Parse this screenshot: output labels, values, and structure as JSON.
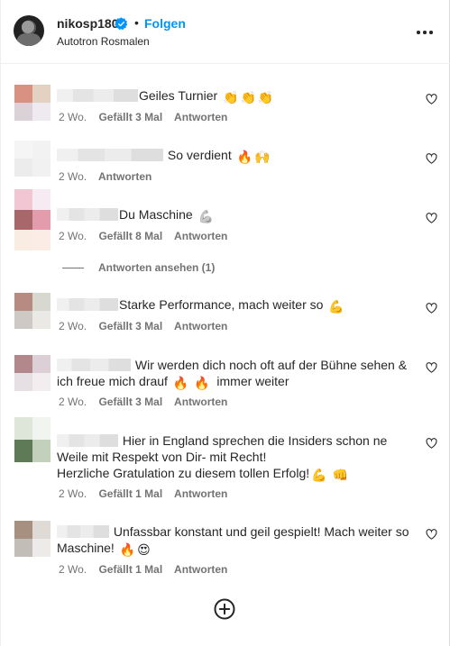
{
  "header": {
    "username": "nikosp180",
    "dot": "•",
    "follow_label": "Folgen",
    "location": "Autotron Rosmalen",
    "verified_icon": "verified-badge-icon",
    "more_icon": "more-options-icon"
  },
  "comments": [
    {
      "text": "Geiles Turnier",
      "emoji": [
        "clapping-hands-icon",
        "clapping-hands-icon",
        "clapping-hands-icon"
      ],
      "time": "2 Wo.",
      "likes": "Gefällt 3 Mal",
      "reply": "Antworten"
    },
    {
      "text": "So verdient",
      "emoji": [
        "fire-icon",
        "raising-hands-icon"
      ],
      "time": "2 Wo.",
      "likes": "",
      "reply": "Antworten"
    },
    {
      "text": "Du Maschine",
      "emoji": [
        "flexed-biceps-icon"
      ],
      "time": "2 Wo.",
      "likes": "Gefällt 8 Mal",
      "reply": "Antworten"
    },
    {
      "text": "Starke Performance, mach weiter so",
      "emoji": [
        "flexed-biceps-icon"
      ],
      "time": "2 Wo.",
      "likes": "Gefällt 3 Mal",
      "reply": "Antworten"
    },
    {
      "text_line1": "Wir werden dich noch oft auf der Bühne sehen &",
      "text_line2": "ich freue mich drauf",
      "text_line2_end": "immer weiter",
      "emoji": [
        "fire-icon",
        "fire-icon"
      ],
      "time": "2 Wo.",
      "likes": "Gefällt 3 Mal",
      "reply": "Antworten"
    },
    {
      "text_line1": "Hier in England sprechen die Insiders schon ne",
      "text_line2": "Weile mit Respekt von Dir- mit Recht!",
      "text_line3": "Herzliche Gratulation zu diesem tollen Erfolg!",
      "emoji": [
        "flexed-biceps-icon",
        "fist-icon"
      ],
      "time": "2 Wo.",
      "likes": "Gefällt 1 Mal",
      "reply": "Antworten"
    },
    {
      "text_line1": "Unfassbar konstant und geil gespielt! Mach weiter so",
      "text_line2": "Maschine!",
      "emoji": [
        "fire-icon",
        "heart-eyes-icon"
      ],
      "time": "2 Wo.",
      "likes": "Gefällt 1 Mal",
      "reply": "Antworten"
    }
  ],
  "view_replies": "Antworten ansehen (1)",
  "icons": {
    "like": "heart-outline-icon",
    "add": "add-comment-icon"
  },
  "colors": {
    "accent": "#0095f6",
    "text": "#262626",
    "secondary": "#737373",
    "border": "#efefef"
  }
}
